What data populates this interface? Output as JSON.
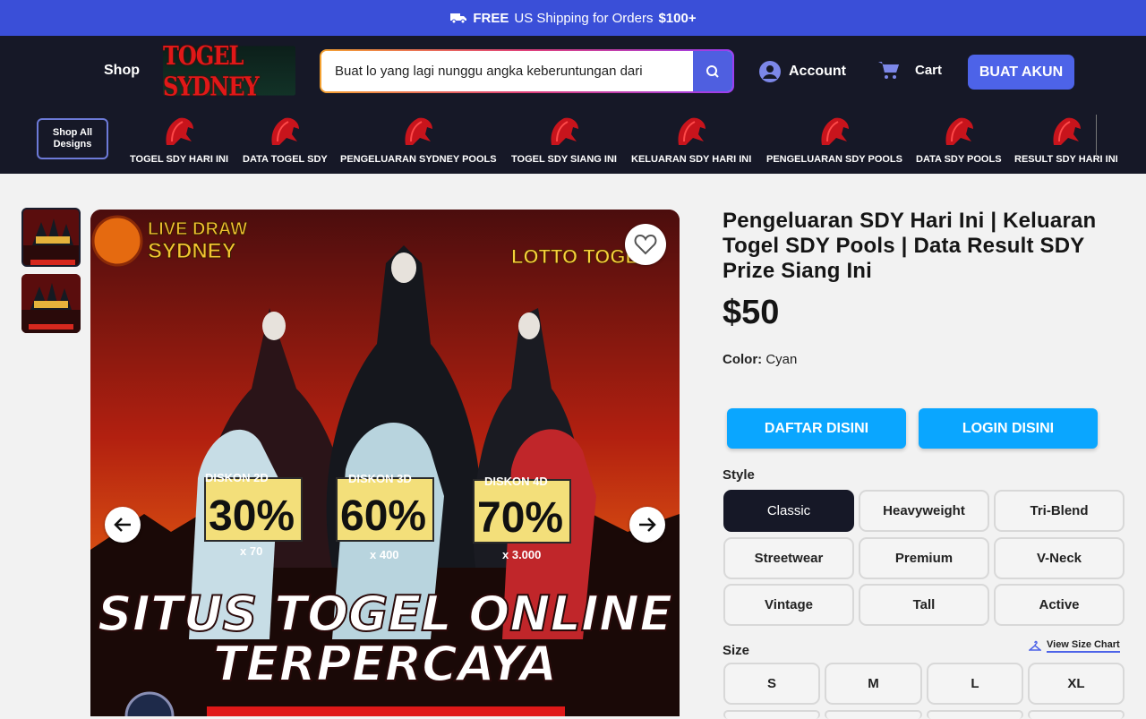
{
  "promo": {
    "free": "FREE",
    "text": "US Shipping for Orders",
    "amount": "$100+"
  },
  "header": {
    "shop": "Shop",
    "logo_text": "TOGEL SYDNEY",
    "search_value": "Buat lo yang lagi nunggu angka keberuntungan dari",
    "account": "Account",
    "cart": "Cart",
    "signup": "BUAT AKUN",
    "shop_all": "Shop All Designs"
  },
  "categories": [
    "TOGEL SDY HARI INI",
    "DATA TOGEL SDY",
    "PENGELUARAN SYDNEY POOLS",
    "TOGEL SDY SIANG INI",
    "KELUARAN SDY HARI INI",
    "PENGELUARAN SDY POOLS",
    "DATA SDY POOLS",
    "RESULT SDY HARI INI"
  ],
  "image": {
    "brand_left_1": "LIVE DRAW",
    "brand_left_2": "SYDNEY",
    "brand_right": "LOTTO TOGEL",
    "discounts": [
      {
        "label": "DISKON 2D",
        "pct": "30%",
        "mult": "x 70"
      },
      {
        "label": "DISKON 3D",
        "pct": "60%",
        "mult": "x 400"
      },
      {
        "label": "DISKON 4D",
        "pct": "70%",
        "mult": "x 3.000"
      }
    ],
    "headline_1": "SITUS TOGEL ONLINE",
    "headline_2": "TERPERCAYA"
  },
  "product": {
    "title": "Pengeluaran SDY Hari Ini | Keluaran Togel SDY Pools | Data Result SDY Prize Siang Ini",
    "price": "$50",
    "color_label": "Color:",
    "color_value": "Cyan",
    "daftar": "DAFTAR DISINI",
    "login": "LOGIN DISINI",
    "style_label": "Style",
    "styles": [
      "Classic",
      "Heavyweight",
      "Tri-Blend",
      "Streetwear",
      "Premium",
      "V-Neck",
      "Vintage",
      "Tall",
      "Active"
    ],
    "selected_style": "Classic",
    "size_label": "Size",
    "size_chart": "View Size Chart",
    "sizes": [
      "S",
      "M",
      "L",
      "XL"
    ]
  },
  "colors": {
    "accent": "#4d63e8",
    "cta": "#0aa6ff",
    "header_bg": "#161827"
  }
}
